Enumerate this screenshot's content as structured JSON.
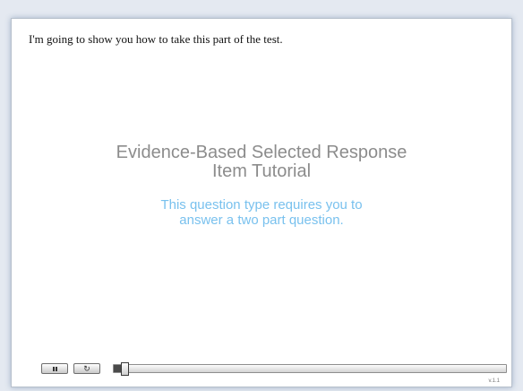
{
  "tutorial": {
    "intro_text": "I'm going to show you how to take this part of the test.",
    "title_line1": "Evidence-Based Selected Response",
    "title_line2": "Item Tutorial",
    "subtitle_line1": "This question type requires you to",
    "subtitle_line2": "answer a two part question."
  },
  "player": {
    "pause_icon": "pause-icon",
    "replay_icon": "replay-icon",
    "progress": 0.02,
    "version": "v.1.1"
  },
  "colors": {
    "title": "#8c8c8c",
    "subtitle": "#79c1ee",
    "frame_glow": "#506e96"
  }
}
